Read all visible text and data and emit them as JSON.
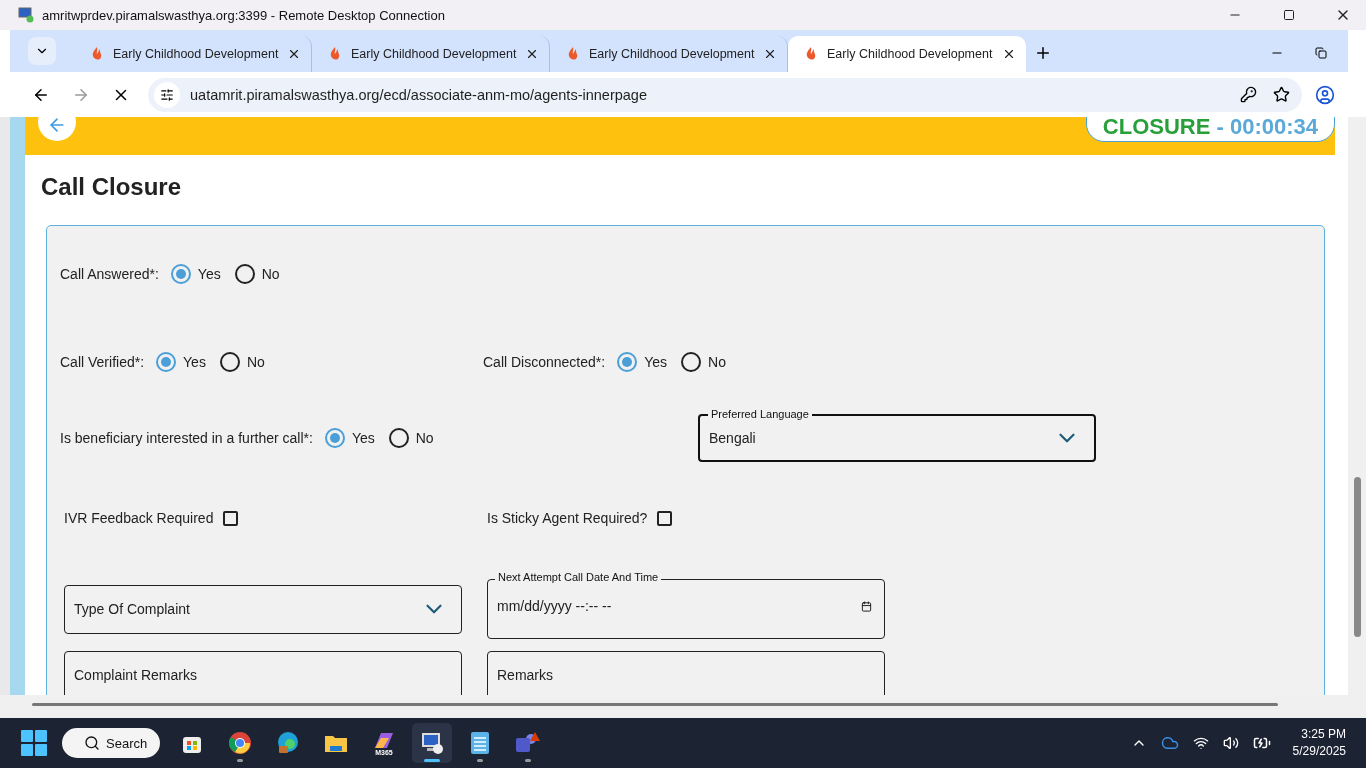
{
  "remote_window": {
    "title": "amritwprdev.piramalswasthya.org:3399 - Remote Desktop Connection"
  },
  "browser": {
    "tabs": [
      {
        "title": "Early Childhood Development",
        "selected": false
      },
      {
        "title": "Early Childhood Development",
        "selected": false
      },
      {
        "title": "Early Childhood Development",
        "selected": false
      },
      {
        "title": "Early Childhood Development",
        "selected": true
      }
    ],
    "url": "uatamrit.piramalswasthya.org/ecd/associate-anm-mo/agents-innerpage"
  },
  "header": {
    "status": "CLOSURE",
    "timer": " - 00:00:34"
  },
  "page": {
    "title": "Call Closure"
  },
  "form": {
    "rows": [
      {
        "items": [
          {
            "kind": "radio",
            "label": "Call Answered*:",
            "options": [
              {
                "label": "Yes",
                "selected": true
              },
              {
                "label": "No",
                "selected": false
              }
            ]
          }
        ]
      },
      {
        "items": [
          {
            "kind": "radio",
            "label": "Call Verified*:",
            "options": [
              {
                "label": "Yes",
                "selected": true
              },
              {
                "label": "No",
                "selected": false
              }
            ]
          },
          {
            "kind": "radio",
            "label": "Call Disconnected*:",
            "options": [
              {
                "label": "Yes",
                "selected": true
              },
              {
                "label": "No",
                "selected": false
              }
            ]
          }
        ]
      },
      {
        "items": [
          {
            "kind": "radio",
            "label": "Is beneficiary interested in a further call*:",
            "options": [
              {
                "label": "Yes",
                "selected": true
              },
              {
                "label": "No",
                "selected": false
              }
            ]
          },
          {
            "kind": "select",
            "label": "Preferred Language",
            "value": "Bengali"
          }
        ]
      },
      {
        "items": [
          {
            "kind": "checkbox",
            "label": "IVR Feedback Required",
            "checked": false
          },
          {
            "kind": "checkbox",
            "label": "Is Sticky Agent Required?",
            "checked": false
          }
        ]
      },
      {
        "items": [
          {
            "kind": "select",
            "placeholder": "Type Of Complaint"
          },
          {
            "kind": "datetime",
            "label": "Next Attempt Call Date And Time",
            "value": "mm/dd/yyyy --:-- --"
          }
        ]
      },
      {
        "items": [
          {
            "kind": "textarea",
            "placeholder": "Complaint Remarks"
          },
          {
            "kind": "textarea",
            "placeholder": "Remarks"
          }
        ]
      }
    ]
  },
  "taskbar": {
    "search": "Search",
    "apps": [
      {
        "kind": "store",
        "running": false,
        "selected": false
      },
      {
        "kind": "chrome",
        "running": true,
        "selected": false
      },
      {
        "kind": "edge",
        "running": false,
        "selected": false
      },
      {
        "kind": "folder",
        "running": false,
        "selected": false
      },
      {
        "kind": "m365",
        "badge": "M365",
        "running": false,
        "selected": false
      },
      {
        "kind": "remote",
        "running": true,
        "selected": true
      },
      {
        "kind": "notepad",
        "running": true,
        "selected": false
      },
      {
        "kind": "teams",
        "running": true,
        "selected": false
      }
    ],
    "time": "3:25 PM",
    "date": "5/29/2025"
  }
}
